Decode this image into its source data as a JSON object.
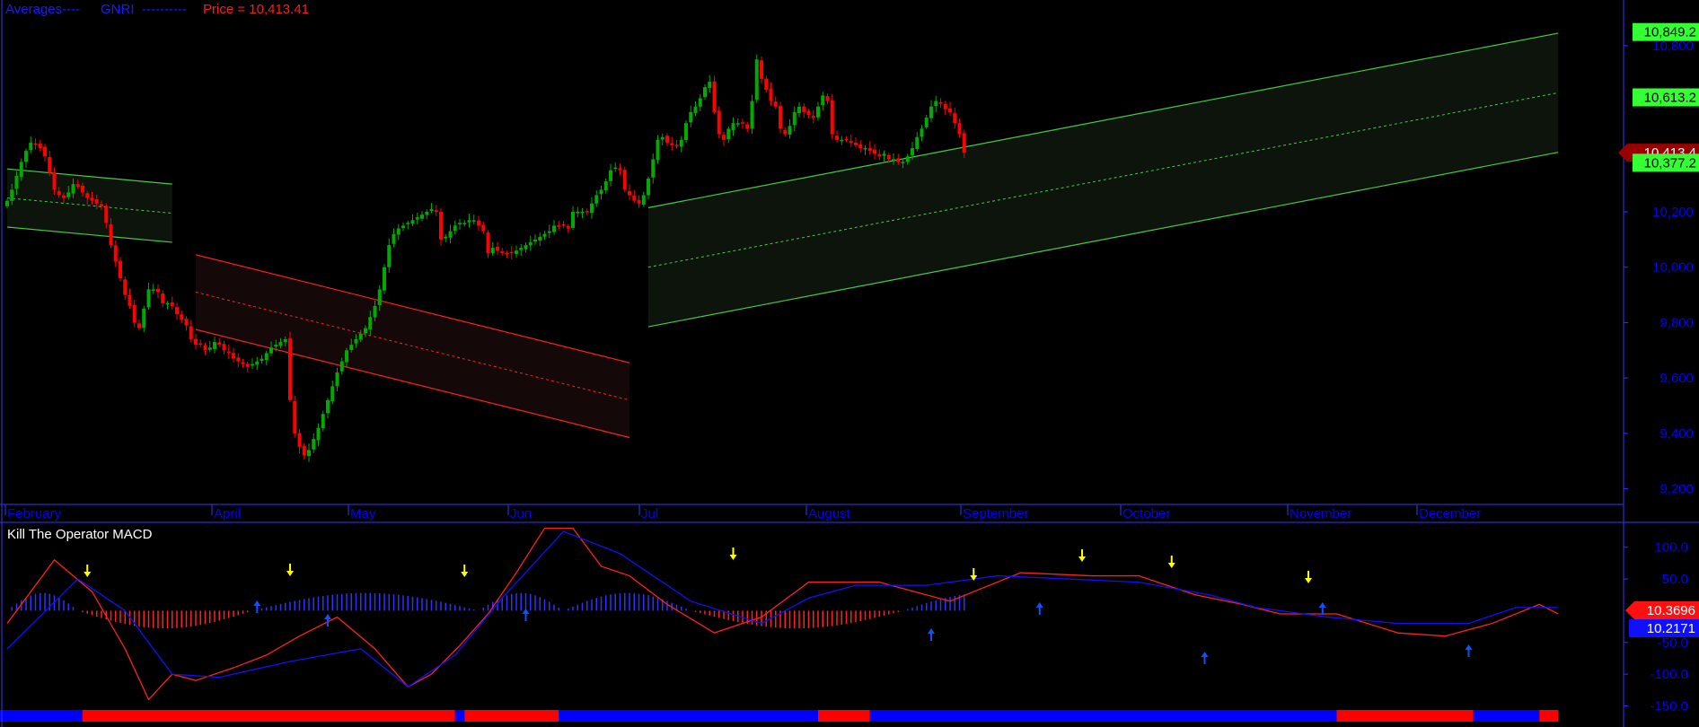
{
  "header": {
    "averages_label": "Averages----",
    "symbol": "GNRI",
    "dashes": "----------",
    "price_label": "Price = 10,413.41"
  },
  "macd_title": "Kill The Operator MACD",
  "colors": {
    "background": "#000000",
    "up_candle": "#00aa00",
    "down_candle": "#ff0000",
    "axis_text": "#0000ff",
    "green_channel": "#44cc44",
    "red_channel": "#ff2020",
    "macd_line": "#ff2020",
    "signal_line": "#1010ff",
    "hist_pos": "#3030ff",
    "hist_neg": "#ff2020",
    "sell_arrow": "#ffff00",
    "buy_arrow": "#1050ff"
  },
  "chart_data": [
    {
      "type": "candlestick",
      "x_labels": [
        "February",
        "April",
        "May",
        "Jun",
        "Jul",
        "August",
        "September",
        "October",
        "November",
        "December"
      ],
      "y_ticks": [
        "9,200",
        "9,400",
        "9,600",
        "9,800",
        "10,000",
        "10,200",
        "10,800"
      ],
      "ylim": [
        9150,
        10900
      ],
      "price_tags": [
        {
          "text": "10,849.2",
          "value": 10849.2,
          "color": "green"
        },
        {
          "text": "10,613.2",
          "value": 10613.2,
          "color": "green"
        },
        {
          "text": "10,413.4",
          "value": 10413.4,
          "color": "darkred"
        },
        {
          "text": "10,377.2",
          "value": 10377.2,
          "color": "green"
        }
      ],
      "channels": [
        {
          "color": "green",
          "x": [
            0,
            35
          ],
          "mid": [
            10250,
            10195
          ],
          "width": 210
        },
        {
          "color": "red",
          "x": [
            40,
            132
          ],
          "mid": [
            9910,
            9520
          ],
          "width": 270
        },
        {
          "color": "green",
          "x": [
            136,
            329
          ],
          "mid": [
            10000,
            10630
          ],
          "width": 430
        }
      ],
      "closes": [
        10240,
        10280,
        10330,
        10380,
        10420,
        10450,
        10445,
        10430,
        10400,
        10340,
        10280,
        10260,
        10250,
        10270,
        10300,
        10290,
        10270,
        10250,
        10240,
        10230,
        10220,
        10160,
        10080,
        10020,
        9960,
        9900,
        9860,
        9800,
        9780,
        9850,
        9920,
        9920,
        9910,
        9870,
        9870,
        9860,
        9830,
        9810,
        9790,
        9740,
        9720,
        9720,
        9700,
        9710,
        9730,
        9720,
        9700,
        9690,
        9670,
        9660,
        9650,
        9640,
        9650,
        9660,
        9670,
        9690,
        9710,
        9720,
        9730,
        9740,
        9520,
        9400,
        9350,
        9320,
        9340,
        9380,
        9420,
        9470,
        9520,
        9570,
        9620,
        9660,
        9700,
        9720,
        9740,
        9760,
        9780,
        9820,
        9860,
        9920,
        10000,
        10080,
        10120,
        10140,
        10150,
        10160,
        10170,
        10180,
        10190,
        10200,
        10210,
        10200,
        10100,
        10110,
        10130,
        10150,
        10160,
        10160,
        10170,
        10170,
        10150,
        10130,
        10050,
        10070,
        10060,
        10050,
        10050,
        10050,
        10060,
        10070,
        10080,
        10090,
        10100,
        10110,
        10120,
        10130,
        10150,
        10150,
        10150,
        10140,
        10200,
        10200,
        10200,
        10200,
        10230,
        10260,
        10280,
        10310,
        10350,
        10360,
        10350,
        10280,
        10260,
        10240,
        10230,
        10260,
        10320,
        10390,
        10460,
        10470,
        10450,
        10440,
        10440,
        10460,
        10520,
        10560,
        10580,
        10610,
        10650,
        10670,
        10560,
        10480,
        10460,
        10500,
        10520,
        10520,
        10520,
        10500,
        10600,
        10750,
        10680,
        10640,
        10600,
        10580,
        10500,
        10480,
        10510,
        10560,
        10580,
        10560,
        10550,
        10540,
        10580,
        10620,
        10600,
        10480,
        10460,
        10460,
        10460,
        10450,
        10440,
        10430,
        10430,
        10420,
        10410,
        10400,
        10410,
        10390,
        10390,
        10380,
        10380,
        10400,
        10430,
        10470,
        10500,
        10540,
        10580,
        10600,
        10590,
        10570,
        10560,
        10520,
        10480,
        10413
      ]
    },
    {
      "type": "line",
      "title": "Kill The Operator MACD",
      "y_ticks": [
        "100.0",
        "50.0",
        "-50.0",
        "-100.0",
        "-150.0"
      ],
      "ylim": [
        -155,
        135
      ],
      "value_tags": [
        {
          "text": "10.3696",
          "value": 10.3696,
          "color": "red"
        },
        {
          "text": "10.2171",
          "value": 10.2171,
          "color": "blue"
        }
      ],
      "series": [
        {
          "name": "",
          "color": "red",
          "x": [
            0,
            10,
            18,
            25,
            30,
            35,
            40,
            48,
            55,
            62,
            70,
            78,
            85,
            90,
            96,
            102,
            108,
            114,
            120,
            126,
            132,
            140,
            150,
            160,
            170,
            185,
            200,
            215,
            230,
            240,
            252,
            262,
            270,
            282,
            295,
            305,
            315,
            325,
            329
          ],
          "y": [
            -20,
            80,
            30,
            -60,
            -140,
            -100,
            -110,
            -90,
            -70,
            -40,
            -10,
            -60,
            -120,
            -100,
            -55,
            -5,
            60,
            130,
            130,
            70,
            55,
            10,
            -35,
            -10,
            45,
            45,
            15,
            60,
            55,
            55,
            25,
            10,
            -5,
            -5,
            -35,
            -40,
            -20,
            10,
            -5
          ]
        },
        {
          "name": "",
          "color": "blue",
          "x": [
            0,
            15,
            25,
            35,
            45,
            60,
            75,
            85,
            95,
            105,
            118,
            130,
            145,
            160,
            170,
            180,
            195,
            210,
            225,
            240,
            255,
            265,
            280,
            295,
            310,
            320,
            329
          ],
          "y": [
            -60,
            50,
            0,
            -100,
            -105,
            -80,
            -60,
            -120,
            -70,
            20,
            125,
            90,
            15,
            -20,
            20,
            40,
            40,
            55,
            50,
            45,
            25,
            5,
            -10,
            -20,
            -20,
            5,
            5
          ]
        }
      ],
      "histogram_sign_bands": [
        {
          "x": [
            0,
            15
          ],
          "sign": "+"
        },
        {
          "x": [
            15,
            52
          ],
          "sign": "-"
        },
        {
          "x": [
            52,
            100
          ],
          "sign": "+"
        },
        {
          "x": [
            100,
            118
          ],
          "sign": "+"
        },
        {
          "x": [
            118,
            145
          ],
          "sign": "+"
        },
        {
          "x": [
            145,
            190
          ],
          "sign": "-"
        },
        {
          "x": [
            190,
            225
          ],
          "sign": "+"
        },
        {
          "x": [
            225,
            252
          ],
          "sign": "-"
        },
        {
          "x": [
            252,
            318
          ],
          "sign": "-"
        },
        {
          "x": [
            318,
            329
          ],
          "sign": "+"
        }
      ],
      "sell_signals_x": [
        17,
        60,
        97,
        154,
        205,
        228,
        247,
        276
      ],
      "buy_signals_x": [
        53,
        68,
        110,
        196,
        219,
        254,
        279,
        310
      ],
      "signal_bar": [
        {
          "x": [
            0,
            16
          ],
          "color": "blue"
        },
        {
          "x": [
            16,
            95
          ],
          "color": "red"
        },
        {
          "x": [
            95,
            97
          ],
          "color": "blue"
        },
        {
          "x": [
            97,
            117
          ],
          "color": "red"
        },
        {
          "x": [
            117,
            172
          ],
          "color": "blue"
        },
        {
          "x": [
            172,
            183
          ],
          "color": "red"
        },
        {
          "x": [
            183,
            282
          ],
          "color": "blue"
        },
        {
          "x": [
            282,
            311
          ],
          "color": "red"
        },
        {
          "x": [
            311,
            325
          ],
          "color": "blue"
        },
        {
          "x": [
            325,
            329
          ],
          "color": "red"
        }
      ]
    }
  ]
}
